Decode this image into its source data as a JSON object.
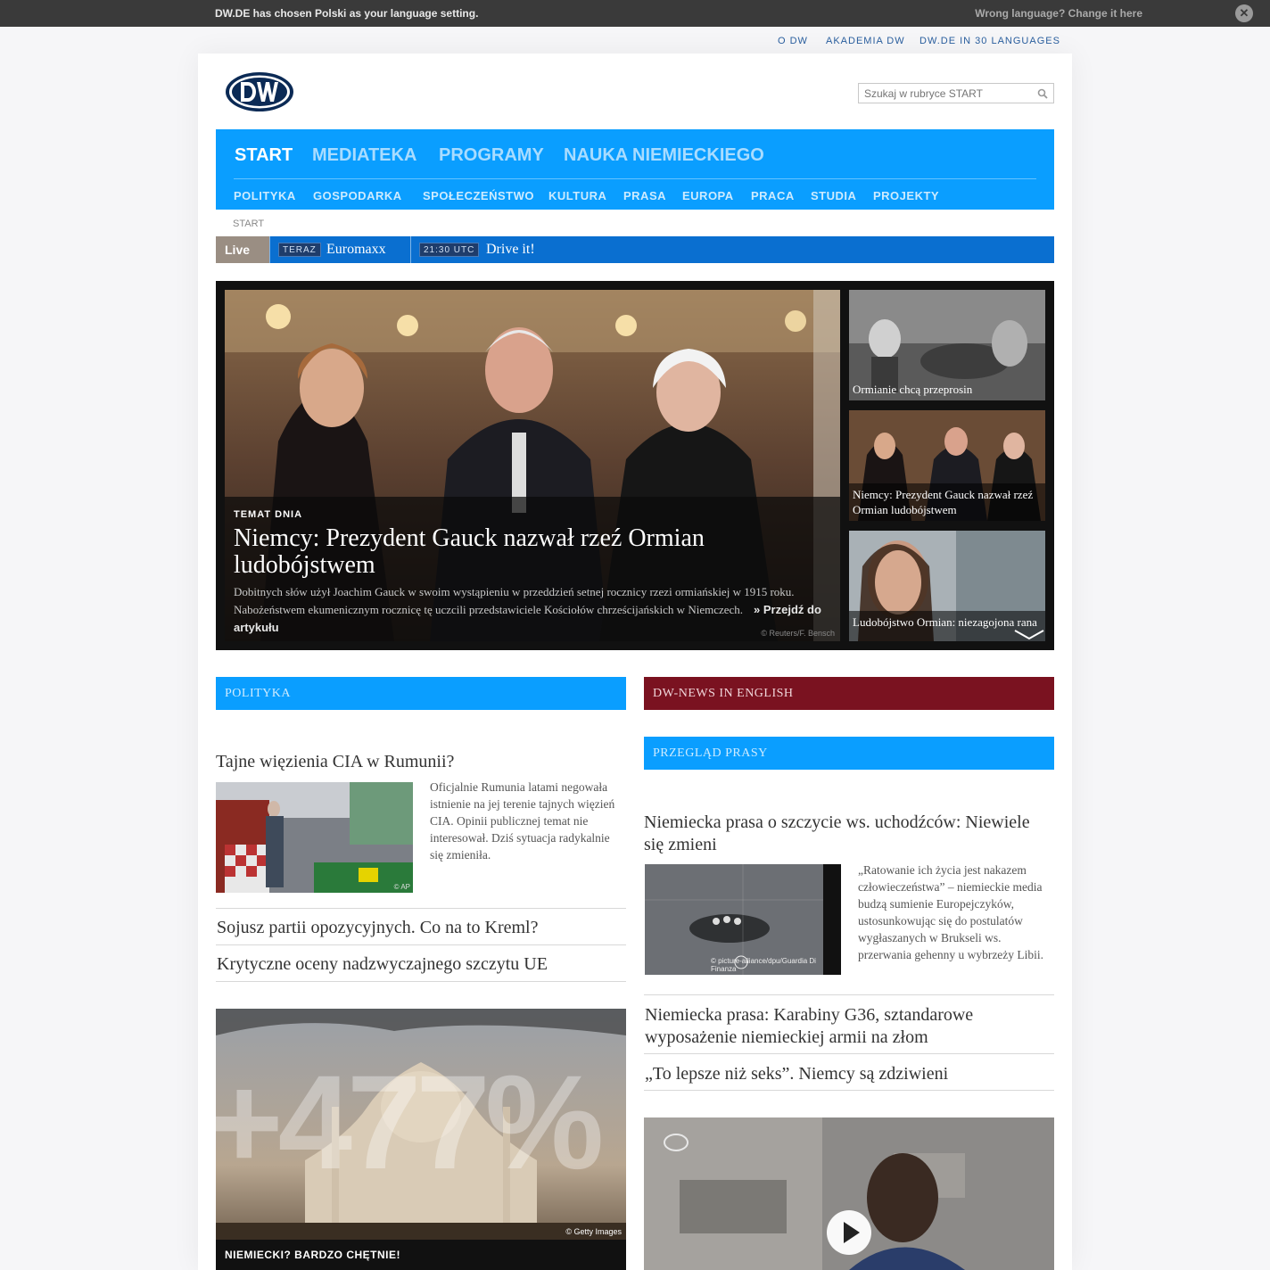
{
  "langbar": {
    "message": "DW.DE has chosen Polski as your language setting.",
    "change": "Wrong language? Change it here",
    "close_icon": "close-icon"
  },
  "service_links": [
    "O DW",
    "AKADEMIA DW",
    "DW.DE IN 30 LANGUAGES"
  ],
  "search": {
    "placeholder": "Szukaj w rubryce START",
    "icon": "search-icon"
  },
  "nav": {
    "main": [
      "START",
      "MEDIATEKA",
      "PROGRAMY",
      "NAUKA NIEMIECKIEGO"
    ],
    "active": "START",
    "sub": [
      "POLITYKA",
      "GOSPODARKA",
      "SPOŁECZEŃSTWO",
      "KULTURA",
      "PRASA",
      "EUROPA",
      "PRACA",
      "STUDIA",
      "PROJEKTY"
    ]
  },
  "breadcrumb": "START",
  "live": {
    "label": "Live",
    "now_tag": "TERAZ",
    "now_show": "Euromaxx",
    "next_tag": "21:30 UTC",
    "next_show": "Drive it!"
  },
  "hero": {
    "kicker": "TEMAT DNIA",
    "title": "Niemcy: Prezydent Gauck nazwał rzeź Ormian ludobójstwem",
    "teaser": "Dobitnych słów użył Joachim Gauck w swoim wystąpieniu w przeddzień setnej rocznicy rzezi ormiańskiej w 1915 roku. Nabożeństwem ekumenicznym rocznicę tę uczcili przedstawiciele Kościołów chrześcijańskich w Niemczech.",
    "more": "» Przejdź do artykułu",
    "credit": "© Reuters/F. Bensch",
    "thumbs": [
      {
        "caption": "Ormianie chcą przeprosin"
      },
      {
        "caption": "Niemcy: Prezydent Gauck nazwał rzeź Ormian ludobójstwem"
      },
      {
        "caption": "Ludobójstwo Ormian: niezagojona rana"
      }
    ]
  },
  "left": {
    "section": "POLITYKA",
    "lead_title": "Tajne więzienia CIA w Rumunii?",
    "lead_text": "Oficjalnie Rumunia latami negowała istnienie na jej terenie tajnych więzień CIA. Opinii publicznej temat nie interesował. Dziś sytuacja radykalnie się zmieniła.",
    "lead_credit": "© AP",
    "links": [
      "Sojusz partii opozycyjnych. Co na to Kreml?",
      "Krytyczne oceny nadzwyczajnego szczytu UE"
    ],
    "promo_big": "+477%",
    "promo_credit": "© Getty Images",
    "promo_caption": "NIEMIECKI? BARDZO CHĘTNIE!"
  },
  "right": {
    "section_news": "DW-NEWS IN ENGLISH",
    "section": "PRZEGLĄD PRASY",
    "lead_title": "Niemiecka prasa o szczycie ws. uchodźców: Niewiele się zmieni",
    "lead_text": "„Ratowanie ich życia jest nakazem człowieczeństwa” – niemieckie media budzą sumienie Europejczyków, ustosunkowując się do postulatów wygłaszanych w Brukseli ws. przerwania gehenny u wybrzeży Libii.",
    "lead_credit": "© picture-alliance/dpu/Guardia Di Finanza",
    "links": [
      "Niemiecka prasa: Karabiny G36, sztandarowe wyposażenie niemieckiej armii na złom",
      "„To lepsze niż seks”. Niemcy są zdziwieni"
    ],
    "video_icon": "play-icon"
  }
}
